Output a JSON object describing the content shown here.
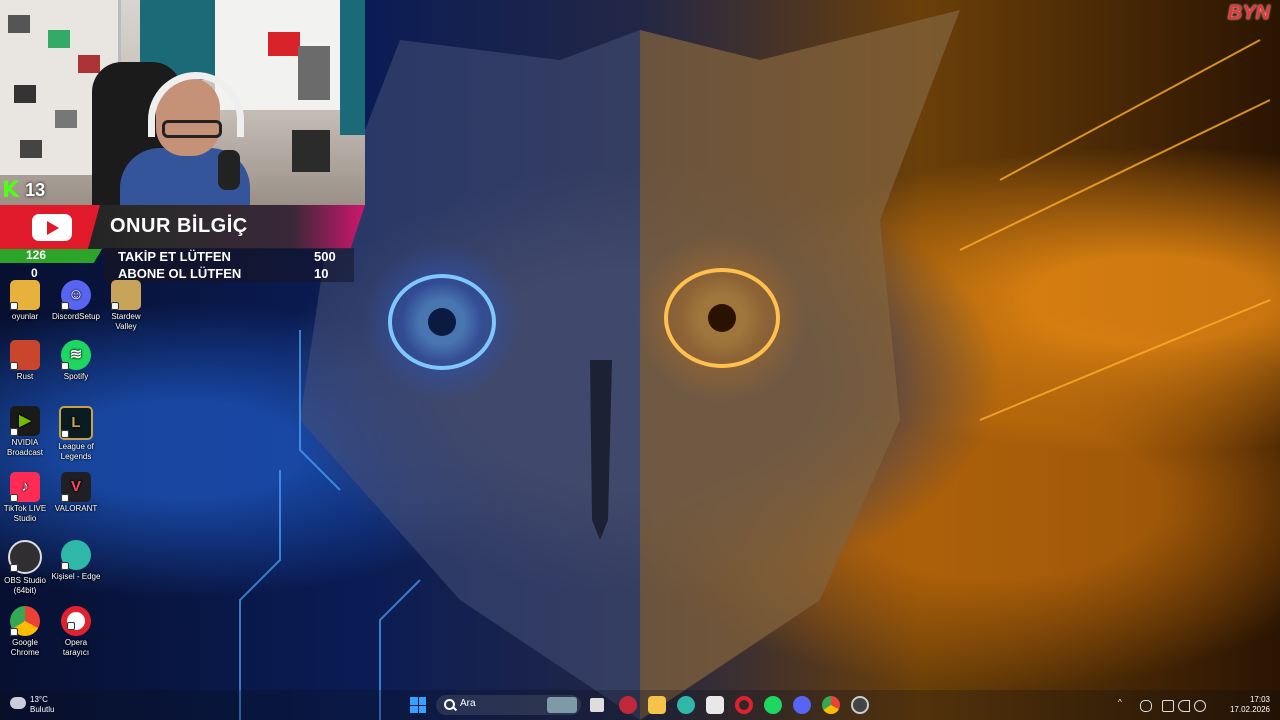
{
  "overlay": {
    "brand_logo": "BYN",
    "kick_count": "13",
    "channel_name": "ONUR BİLGİÇ",
    "green_counter": "126",
    "red_counter": "0",
    "goals": [
      {
        "label": "TAKİP ET LÜTFEN",
        "value": "500"
      },
      {
        "label": "ABONE OL LÜTFEN",
        "value": "10"
      }
    ]
  },
  "desktop_icons": [
    {
      "label": "oyunlar",
      "icon": "folder-icon",
      "color": "#e8b13c"
    },
    {
      "label": "DiscordSetup",
      "icon": "discord-icon",
      "color": "#5865f2"
    },
    {
      "label": "Stardew Valley",
      "icon": "stardew-icon",
      "color": "#c8a45a"
    },
    {
      "label": "Rust",
      "icon": "rust-icon",
      "color": "#c9452b"
    },
    {
      "label": "Spotify",
      "icon": "spotify-icon",
      "color": "#1ed760"
    },
    {
      "label": "NVIDIA Broadcast",
      "icon": "nvidia-icon",
      "color": "#76b900"
    },
    {
      "label": "League of Legends",
      "icon": "lol-icon",
      "color": "#c8a24a"
    },
    {
      "label": "TikTok LIVE Studio",
      "icon": "tiktok-icon",
      "color": "#fe2c55"
    },
    {
      "label": "VALORANT",
      "icon": "valorant-icon",
      "color": "#ff4655"
    },
    {
      "label": "OBS Studio (64bit)",
      "icon": "obs-icon",
      "color": "#302e31"
    },
    {
      "label": "Kişisel - Edge",
      "icon": "edge-icon",
      "color": "#2fb7a8"
    },
    {
      "label": "Google Chrome",
      "icon": "chrome-icon",
      "color": "#fbbc04"
    },
    {
      "label": "Opera tarayıcı",
      "icon": "opera-icon",
      "color": "#e1212e"
    }
  ],
  "taskbar": {
    "weather_temp": "13°C",
    "weather_desc": "Bulutlu",
    "search_placeholder": "Ara",
    "apps": [
      {
        "icon": "task-view-icon",
        "color": "#dddddd"
      },
      {
        "icon": "app-red-icon",
        "color": "#c0283a"
      },
      {
        "icon": "file-explorer-icon",
        "color": "#f5c24a"
      },
      {
        "icon": "edge-icon",
        "color": "#2fb7a8"
      },
      {
        "icon": "store-icon",
        "color": "#e8e8e8"
      },
      {
        "icon": "opera-icon",
        "color": "#e1212e"
      },
      {
        "icon": "spotify-icon",
        "color": "#1ed760"
      },
      {
        "icon": "discord-icon",
        "color": "#5865f2"
      },
      {
        "icon": "chrome-icon",
        "color": "#fbbc04"
      },
      {
        "icon": "obs-icon",
        "color": "#444444"
      }
    ],
    "time": "17:03",
    "date": "17.02.2026"
  }
}
